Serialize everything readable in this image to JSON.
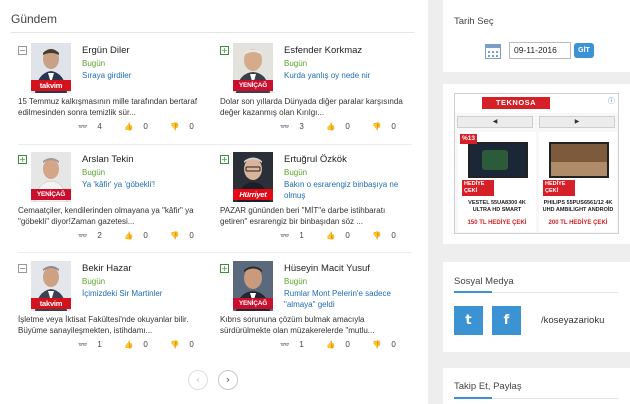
{
  "main": {
    "title": "Gündem",
    "cards": [
      {
        "toggle": "−",
        "author": "Ergün Diler",
        "date": "Bugün",
        "headline": "Sıraya girdiler",
        "summary": "15 Temmuz kalkışmasının mille tarafından bertaraf edilmesinden sonra temizlik sür...",
        "badge": "takvim",
        "stats": {
          "views": "4",
          "likes": "0",
          "dislikes": "0"
        }
      },
      {
        "toggle": "+",
        "author": "Esfender Korkmaz",
        "date": "Bugün",
        "headline": "Kurda yanlış oy nede nir",
        "summary": "Dolar son yıllarda Dünyada diğer paralar karşısında değer kazanmış olan Kırılgı...",
        "badge": "YENİÇAĞ",
        "stats": {
          "views": "3",
          "likes": "0",
          "dislikes": "0"
        }
      },
      {
        "toggle": "+",
        "author": "Arslan Tekin",
        "date": "Bugün",
        "headline": "Ya 'kâfir' ya 'göbekli'!",
        "summary": "Cemaatçiler, kendilerinden olmayana ya \"kâfir\" ya \"göbekli\" diyor!Zaman gazetesi...",
        "badge": "YENİÇAĞ",
        "stats": {
          "views": "2",
          "likes": "0",
          "dislikes": "0"
        }
      },
      {
        "toggle": "+",
        "author": "Ertuğrul Özkök",
        "date": "Bugün",
        "headline": "Bakın o esrarengiz binbaşıya ne olmuş",
        "summary": "PAZAR gününden beri \"MİT\"e darbe istihbaratı getiren\" esrarengiz bir binbaşıdan söz ...",
        "badge": "Hürriyet",
        "stats": {
          "views": "1",
          "likes": "0",
          "dislikes": "0"
        }
      },
      {
        "toggle": "−",
        "author": "Bekir Hazar",
        "date": "Bugün",
        "headline": "İçimizdeki Sir Martinler",
        "summary": "İşletme veya İktisat Fakültesi'nde okuyanlar bilir. Büyüme sanayileşmekten, istihdamı...",
        "badge": "takvim",
        "stats": {
          "views": "1",
          "likes": "0",
          "dislikes": "0"
        }
      },
      {
        "toggle": "+",
        "author": "Hüseyin Macit Yusuf",
        "date": "Bugün",
        "headline": "Rumlar Mont Pelerin'e sadece \"almaya\" geldi",
        "summary": "Kıbrıs sorununa çözüm bulmak amacıyla sürdürülmekte olan müzakerelerde \"mutlu...",
        "badge": "YENİÇAĞ",
        "stats": {
          "views": "1",
          "likes": "0",
          "dislikes": "0"
        }
      }
    ],
    "pager": {
      "prev": "‹",
      "next": "›"
    }
  },
  "sidebar": {
    "date_title": "Tarih Seç",
    "date_value": "09-11-2016",
    "go_label": "GİT",
    "ad": {
      "brand": "TEKNOSA",
      "info": "ⓘ",
      "prev_arrow": "◀",
      "next_arrow": "▶",
      "items": [
        {
          "pct": "%13",
          "gift": "HEDİYE ÇEKİ",
          "name": "VESTEL 55UA8300 4K ULTRA HD SMART",
          "price": "150 TL HEDİYE ÇEKİ"
        },
        {
          "pct": "",
          "gift": "HEDİYE ÇEKİ",
          "name": "PHILIPS 55PUS6561/12 4K UHD AMBILIGHT ANDROİD",
          "price": "200 TL HEDİYE ÇEKİ"
        }
      ]
    },
    "social_title": "Sosyal Medya",
    "twitter_glyph": "t",
    "facebook_glyph": "f",
    "social_handle": "/koseyazarioku",
    "follow_title": "Takip Et, Paylaş"
  },
  "colors": {
    "accent": "#3c93d4",
    "date_green": "#5aa42c",
    "link_blue": "#1e6db4",
    "brand_red": "#d61f26"
  }
}
